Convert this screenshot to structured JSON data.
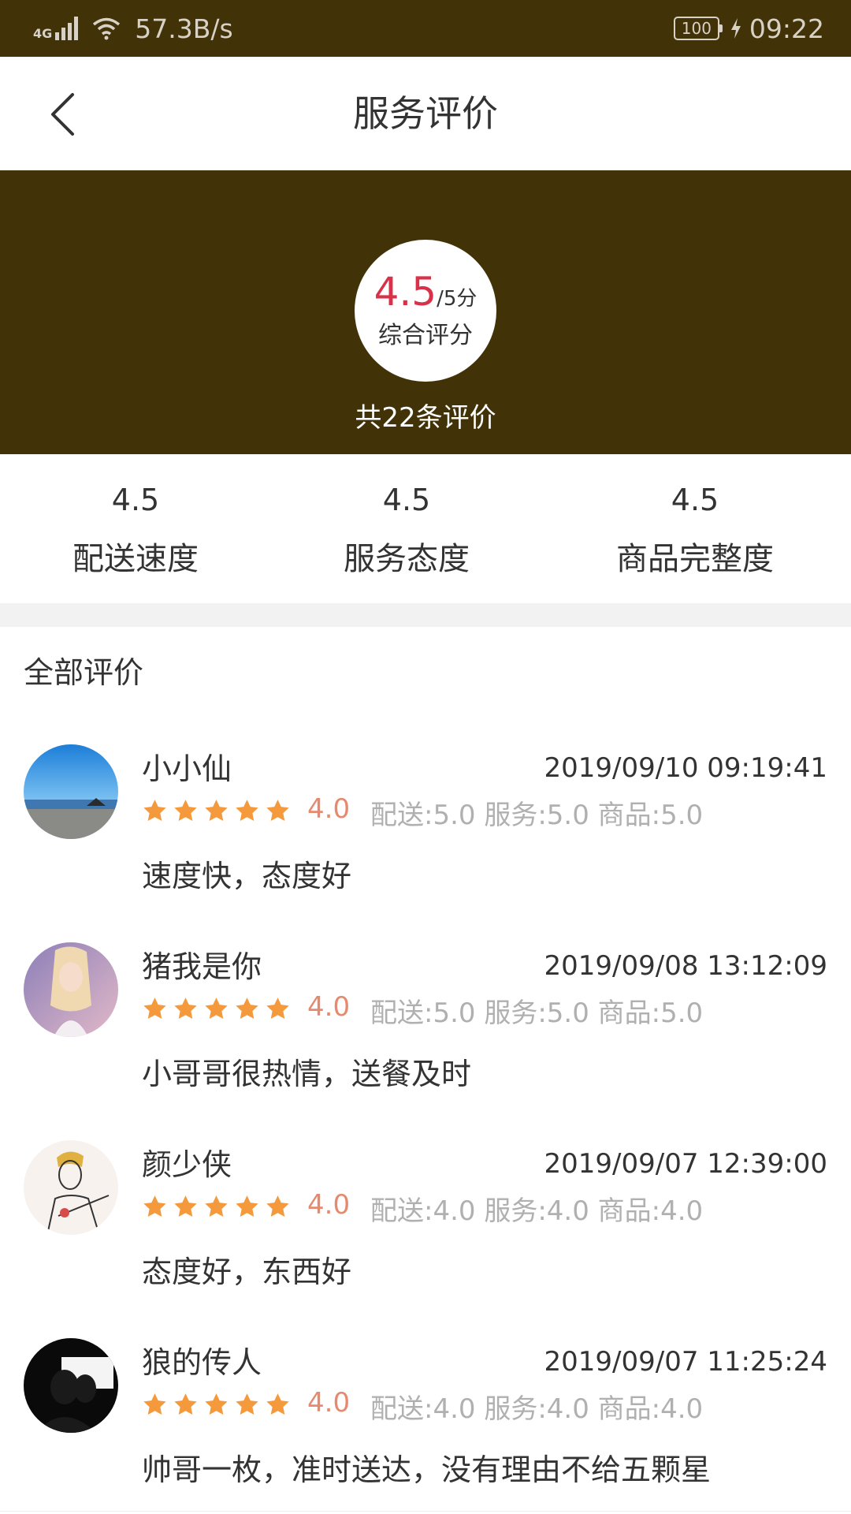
{
  "status_bar": {
    "network": "4G",
    "speed": "57.3B/s",
    "battery": "100",
    "time": "09:22"
  },
  "header": {
    "title": "服务评价",
    "back_icon": "chevron-left-icon"
  },
  "summary": {
    "score": "4.5",
    "out_of": "/5分",
    "score_label": "综合评分",
    "count_text": "共22条评价",
    "bg_color": "#423208",
    "score_color": "#d8324a"
  },
  "metrics": [
    {
      "value": "4.5",
      "label": "配送速度"
    },
    {
      "value": "4.5",
      "label": "服务态度"
    },
    {
      "value": "4.5",
      "label": "商品完整度"
    }
  ],
  "reviews_section": {
    "title": "全部评价"
  },
  "reviews": [
    {
      "name": "小小仙",
      "date": "2019/09/10 09:19:41",
      "stars": 5,
      "rating": "4.0",
      "subscores": "配送:5.0 服务:5.0 商品:5.0",
      "comment": "速度快，态度好"
    },
    {
      "name": "猪我是你",
      "date": "2019/09/08 13:12:09",
      "stars": 5,
      "rating": "4.0",
      "subscores": "配送:5.0 服务:5.0 商品:5.0",
      "comment": "小哥哥很热情，送餐及时"
    },
    {
      "name": "颜少侠",
      "date": "2019/09/07 12:39:00",
      "stars": 5,
      "rating": "4.0",
      "subscores": "配送:4.0 服务:4.0 商品:4.0",
      "comment": "态度好，东西好"
    },
    {
      "name": "狼的传人",
      "date": "2019/09/07 11:25:24",
      "stars": 5,
      "rating": "4.0",
      "subscores": "配送:4.0 服务:4.0 商品:4.0",
      "comment": "帅哥一枚，准时送达，没有理由不给五颗星"
    }
  ],
  "colors": {
    "star": "#f59a3c",
    "rating": "#e58a6e"
  }
}
